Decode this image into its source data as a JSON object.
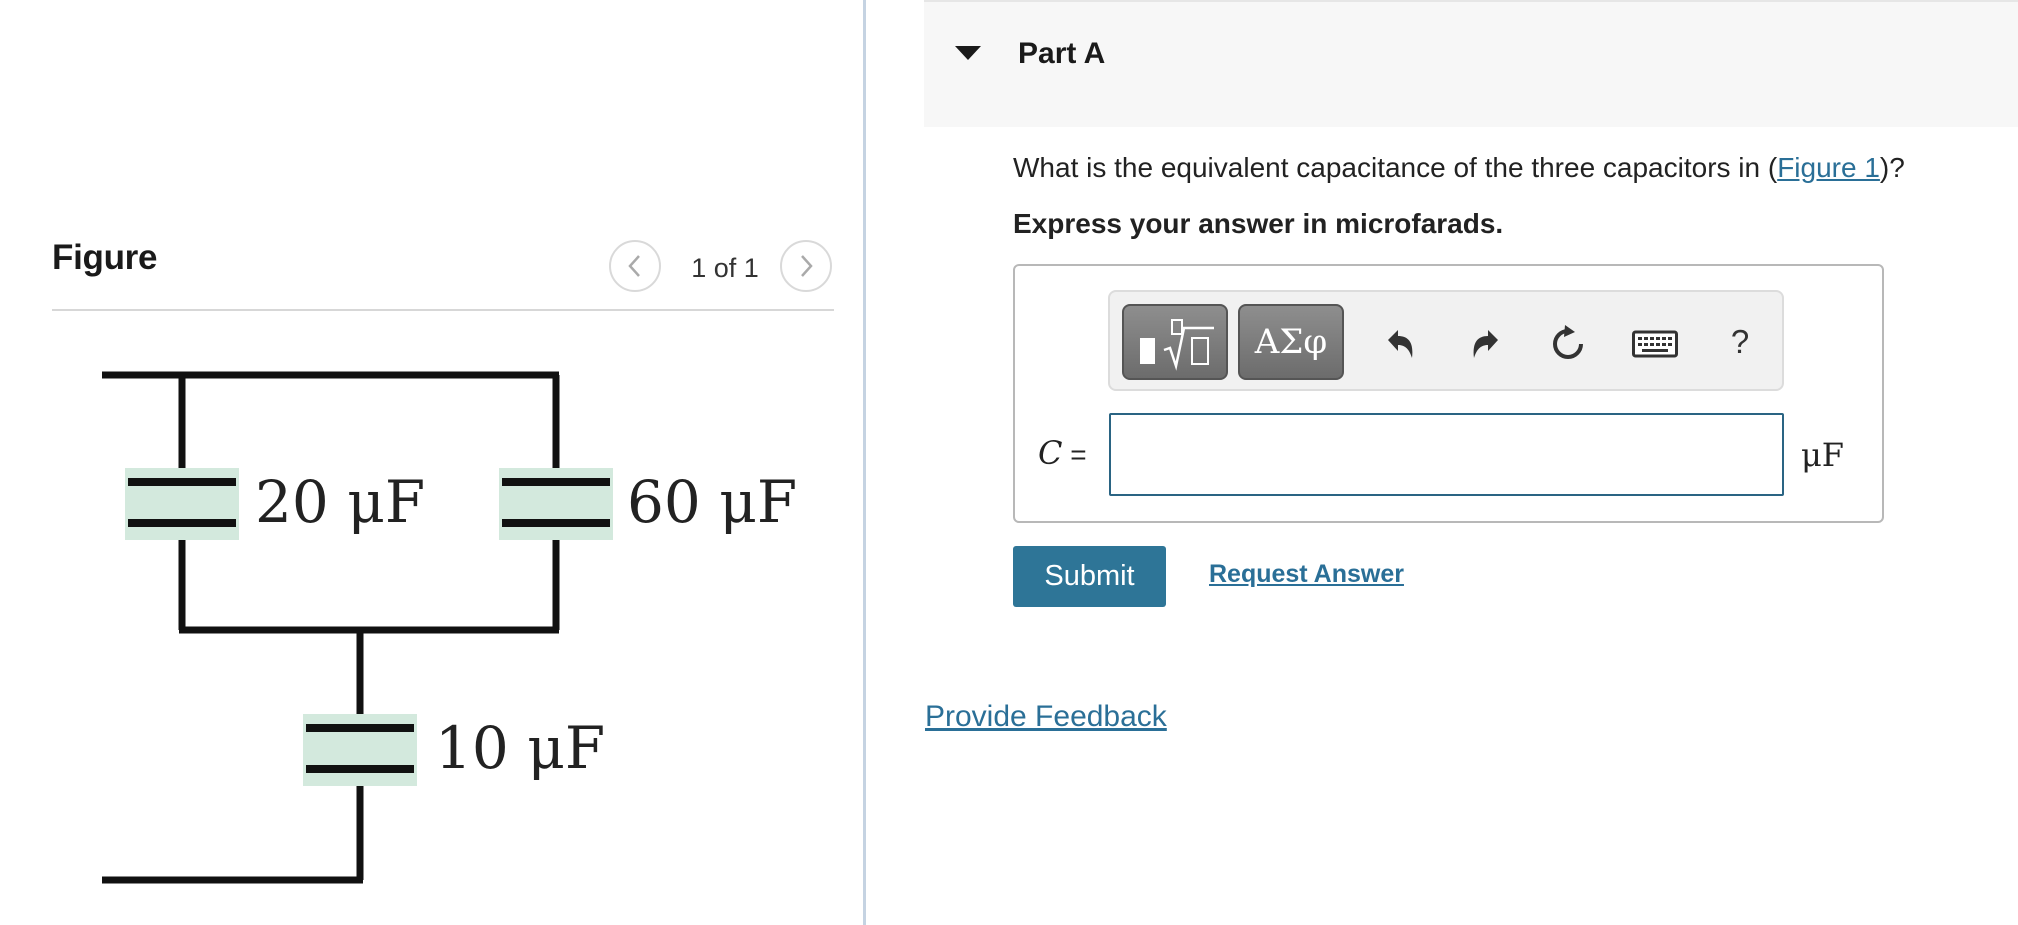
{
  "figure_panel": {
    "title": "Figure",
    "counter": "1 of 1",
    "prev_icon": "chevron-left-icon",
    "next_icon": "chevron-right-icon",
    "capacitors": {
      "c1_label": "20 μF",
      "c2_label": "60 μF",
      "c3_label": "10 μF"
    },
    "colors": {
      "capacitor_fill": "#d3e9dd",
      "wire": "#111111"
    }
  },
  "part": {
    "title": "Part A",
    "toggle_icon": "triangle-down-icon"
  },
  "question": {
    "text_before": "What is the equivalent capacitance of the three capacitors in (",
    "link_text": "Figure 1",
    "text_after": ")?",
    "instruction": "Express your answer in microfarads."
  },
  "toolbar": {
    "templates_icon": "templates-icon",
    "symbols_label": "ΑΣφ",
    "undo_icon": "undo-icon",
    "redo_icon": "redo-icon",
    "reset_icon": "reset-icon",
    "keyboard_icon": "keyboard-icon",
    "help_label": "?"
  },
  "answer": {
    "variable": "C",
    "equals": " =",
    "value": "",
    "unit": "μF"
  },
  "actions": {
    "submit_label": "Submit",
    "request_answer_label": "Request Answer",
    "feedback_label": "Provide Feedback"
  },
  "colors": {
    "accent": "#2e7597",
    "link": "#2a6f97",
    "input_border": "#2a6483"
  }
}
